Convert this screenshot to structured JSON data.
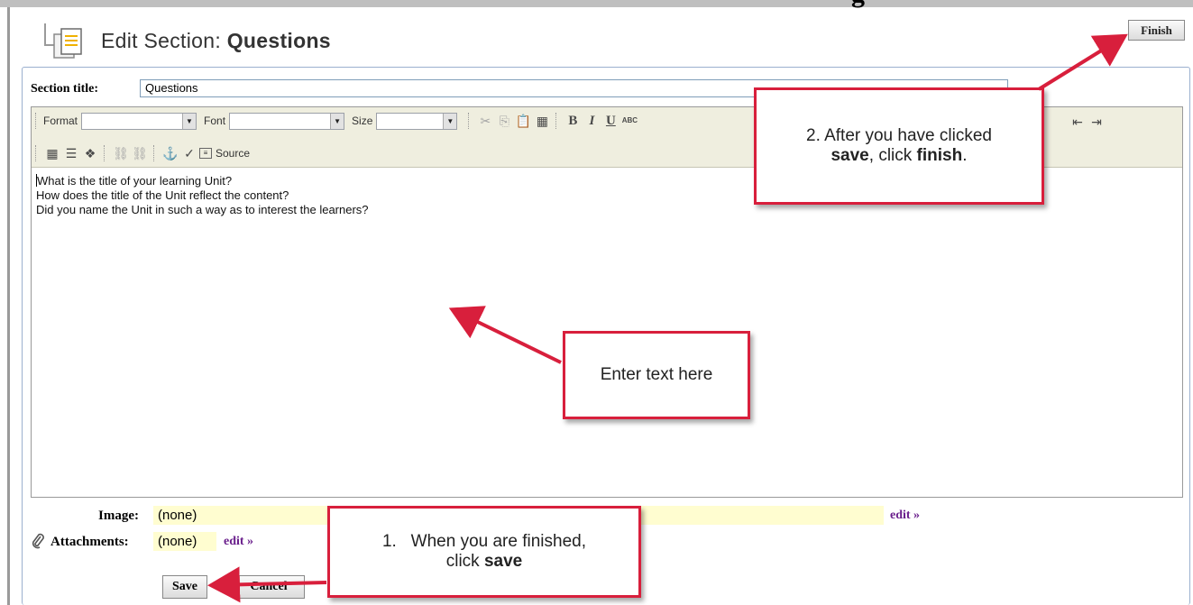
{
  "page": {
    "heading_fragment": "g",
    "title_prefix": "Edit Section:",
    "title_name": "Questions",
    "finish_label": "Finish"
  },
  "section": {
    "label": "Section title:",
    "value": "Questions"
  },
  "toolbar": {
    "format_label": "Format",
    "font_label": "Font",
    "size_label": "Size",
    "source_label": "Source"
  },
  "editor": {
    "lines": [
      "What is the title of your learning Unit?",
      "How does the title of the Unit reflect the content?",
      "Did you name the Unit in such a way as to interest the learners?"
    ]
  },
  "image": {
    "label": "Image:",
    "value": "(none)",
    "edit_label": "edit »"
  },
  "attachments": {
    "label": "Attachments:",
    "value": "(none)",
    "edit_label": "edit »"
  },
  "buttons": {
    "save": "Save",
    "cancel": "Cancel"
  },
  "callouts": {
    "finish": {
      "line1": "2. After you have clicked",
      "line2_bold1": "save",
      "line2_mid": ", click ",
      "line2_bold2": "finish",
      "line2_end": "."
    },
    "enter": {
      "text": "Enter text here"
    },
    "save": {
      "line1": "1.   When you are finished,",
      "line2_pre": "click ",
      "line2_bold": "save"
    }
  },
  "colors": {
    "callout_border": "#d81f3c",
    "link": "#6a1f8c",
    "highlight": "#fffdd0"
  },
  "icons": [
    "page-icon",
    "cut-icon",
    "copy-icon",
    "paste-icon",
    "paste-word-icon",
    "bold-icon",
    "italic-icon",
    "underline-icon",
    "strike-icon",
    "outdent-icon",
    "indent-icon",
    "table-icon",
    "horizontal-rule-icon",
    "special-char-icon",
    "link-icon",
    "unlink-icon",
    "anchor-icon",
    "spellcheck-icon",
    "source-icon",
    "paperclip-icon"
  ]
}
